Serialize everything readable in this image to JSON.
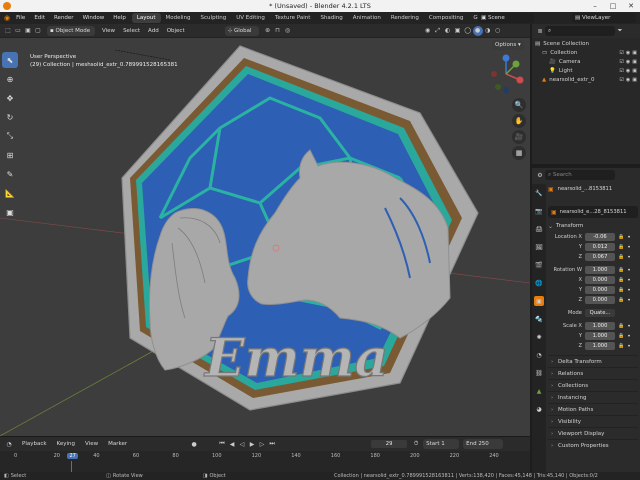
{
  "window": {
    "title": "* (Unsaved) - Blender 4.2.1 LTS",
    "controls": [
      "–",
      "□",
      "✕"
    ]
  },
  "menubar": {
    "items": [
      "File",
      "Edit",
      "Render",
      "Window",
      "Help"
    ],
    "workspaces": [
      "Layout",
      "Modeling",
      "Sculpting",
      "UV Editing",
      "Texture Paint",
      "Shading",
      "Animation",
      "Rendering",
      "Compositing",
      "Geome"
    ],
    "active_workspace": "Layout",
    "scene": "Scene",
    "view_layer": "ViewLayer"
  },
  "viewport_header": {
    "mode": "Object Mode",
    "menus": [
      "View",
      "Select",
      "Add",
      "Object"
    ],
    "orientation": "Global",
    "options_label": "Options"
  },
  "viewport": {
    "perspective": "User Perspective",
    "collection_info": "(29) Collection | meshsolid_extr_0.789991528165381",
    "model_text": "Emma"
  },
  "outliner": {
    "search_placeholder": "",
    "items": [
      {
        "label": "Scene Collection",
        "indent": 0,
        "icon": "scene-collection-icon"
      },
      {
        "label": "Collection",
        "indent": 1,
        "icon": "collection-icon"
      },
      {
        "label": "Camera",
        "indent": 2,
        "icon": "camera-icon"
      },
      {
        "label": "Light",
        "indent": 2,
        "icon": "light-icon"
      },
      {
        "label": "nearsolid_extr_0",
        "indent": 1,
        "icon": "mesh-icon"
      }
    ]
  },
  "properties": {
    "search_placeholder": "Search",
    "object_name": "nearsolid_...8153811",
    "mesh_name": "nearsolid_e...28_8153811",
    "transform_title": "Transform",
    "location_label": "Location X",
    "location": [
      "-0.06",
      "0.012",
      "0.067"
    ],
    "rotation_label": "Rotation W",
    "rotation": [
      "1.000",
      "0.000",
      "0.000",
      "0.000"
    ],
    "mode_label": "Mode",
    "mode_value": "Quate...",
    "scale_label": "Scale X",
    "scale": [
      "1.000",
      "1.000",
      "1.000"
    ],
    "axis_labels": [
      "Y",
      "Z",
      "X"
    ],
    "panels": [
      "Delta Transform",
      "Relations",
      "Collections",
      "Instancing",
      "Motion Paths",
      "Visibility",
      "Viewport Display",
      "Custom Properties"
    ]
  },
  "timeline": {
    "menus": [
      "Playback",
      "Keying",
      "View",
      "Marker"
    ],
    "current_frame": "29",
    "start_label": "Start",
    "start": "1",
    "end_label": "End",
    "end": "250",
    "ruler": [
      "0",
      "20",
      "27",
      "40",
      "60",
      "80",
      "100",
      "120",
      "140",
      "160",
      "180",
      "200",
      "220",
      "240"
    ]
  },
  "statusbar": {
    "left": [
      "Select",
      "Rotate View",
      "Object"
    ],
    "right": "Collection | nearsolid_extr_0.789991528163811 | Verts:138,420 | Faces:45,148 | Tris:45,140 | Objects:0/2"
  }
}
